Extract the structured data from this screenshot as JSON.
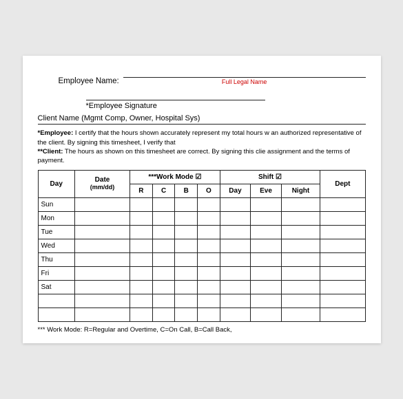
{
  "header": {
    "employee_name_label": "Employee Name:",
    "full_legal_name": "Full Legal Name",
    "signature_label": "*Employee Signature",
    "client_name_label": "Client Name (Mgmt Comp, Owner, Hospital Sys)"
  },
  "certify": {
    "employee_bold": "*Employee:",
    "employee_text": " I certify that the hours shown accurately represent my total hours w an authorized representative of the client. By signing this timesheet, I verify that",
    "client_bold": "**Client:",
    "client_text": "  The hours as shown on this timesheet are correct.  By signing this clie assignment and the terms of payment."
  },
  "table": {
    "headers": {
      "day": "Day",
      "date": "Date",
      "date_sub": "(mm/dd)",
      "workmode": "***Work Mode",
      "workmode_sub_r": "R",
      "workmode_sub_c": "C",
      "workmode_sub_b": "B",
      "workmode_sub_o": "O",
      "shift": "Shift",
      "shift_sub_day": "Day",
      "shift_sub_eve": "Eve",
      "shift_sub_night": "Night",
      "dept": "Dept"
    },
    "rows": [
      {
        "day": "Sun"
      },
      {
        "day": "Mon"
      },
      {
        "day": "Tue"
      },
      {
        "day": "Wed"
      },
      {
        "day": "Thu"
      },
      {
        "day": "Fri"
      },
      {
        "day": "Sat"
      },
      {
        "day": ""
      },
      {
        "day": ""
      }
    ]
  },
  "footer": {
    "note": "*** Work Mode: R=Regular and Overtime, C=On Call, B=Call Back,"
  }
}
